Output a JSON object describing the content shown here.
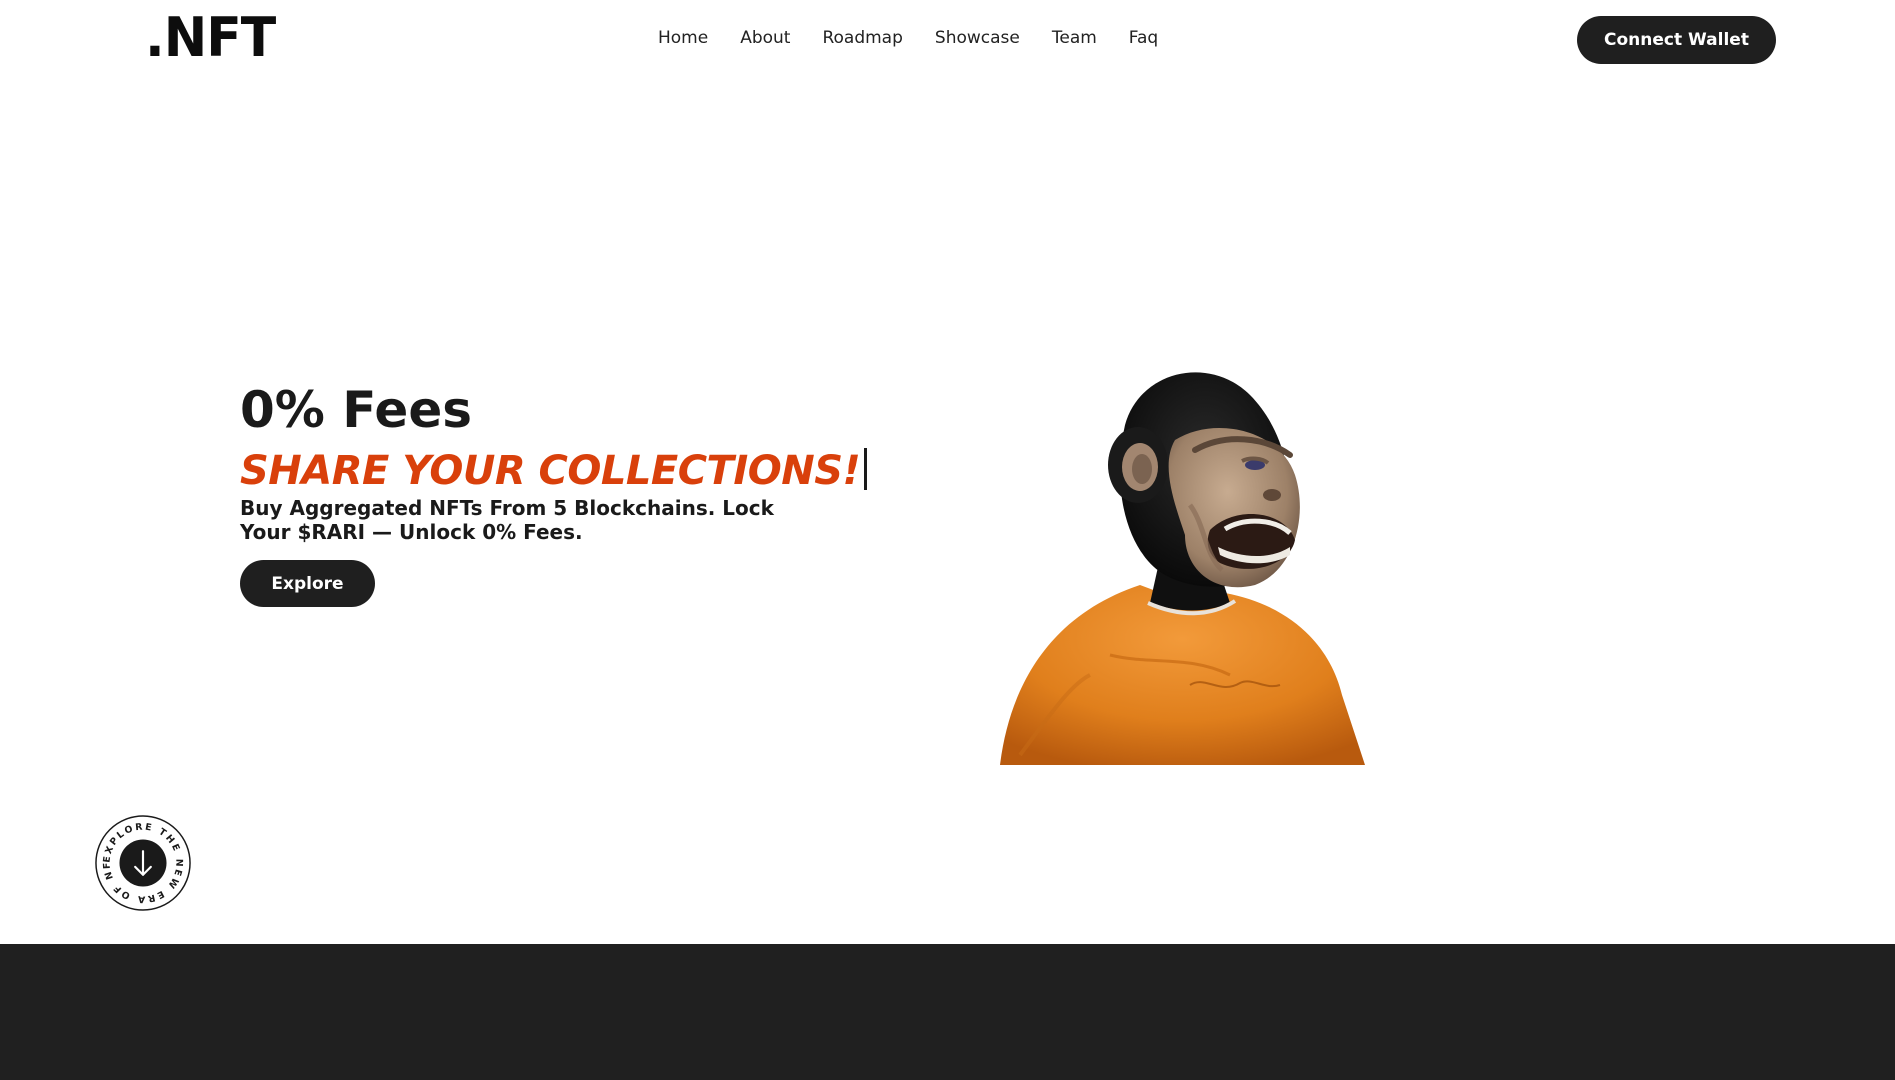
{
  "header": {
    "logo": ".NFT",
    "nav": [
      "Home",
      "About",
      "Roadmap",
      "Showcase",
      "Team",
      "Faq"
    ],
    "connect_label": "Connect Wallet"
  },
  "hero": {
    "title": "0% Fees",
    "typed_text": "SHARE YOUR COLLECTIONS!",
    "subtitle": "Buy Aggregated NFTs From 5 Blockchains. Lock Your $RARI — Unlock 0% Fees.",
    "explore_label": "Explore",
    "illustration": "ape-in-orange-shirt"
  },
  "scroll_badge": {
    "ring_text": "EXPLORE THE NEW ERA OF NFT.",
    "icon": "arrow-down-icon"
  },
  "colors": {
    "accent": "#d9400b",
    "dark": "#202020",
    "background": "#ffffff"
  }
}
